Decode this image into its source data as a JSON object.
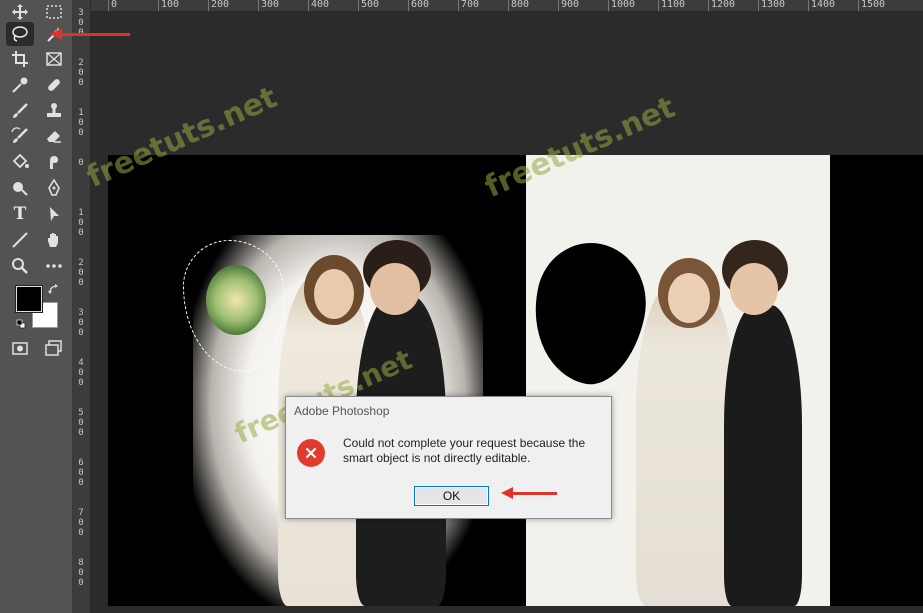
{
  "rulers": {
    "horizontal": [
      "0",
      "100",
      "200",
      "300",
      "400",
      "500",
      "600",
      "700",
      "800",
      "900",
      "1000",
      "1100",
      "1200",
      "1300",
      "1400",
      "1500"
    ],
    "vertical": [
      [
        "3",
        "0",
        "0"
      ],
      [
        "2",
        "0",
        "0"
      ],
      [
        "1",
        "0",
        "0"
      ],
      [
        "0"
      ],
      [
        "1",
        "0",
        "0"
      ],
      [
        "2",
        "0",
        "0"
      ],
      [
        "3",
        "0",
        "0"
      ],
      [
        "4",
        "0",
        "0"
      ],
      [
        "5",
        "0",
        "0"
      ],
      [
        "6",
        "0",
        "0"
      ],
      [
        "7",
        "0",
        "0"
      ],
      [
        "8",
        "0",
        "0"
      ]
    ]
  },
  "tools": {
    "icons": [
      "move-icon",
      "marquee-icon",
      "lasso-icon",
      "quick-selection-icon",
      "crop-icon",
      "frame-icon",
      "eyedropper-icon",
      "healing-brush-icon",
      "brush-icon",
      "clone-stamp-icon",
      "history-brush-icon",
      "eraser-icon",
      "paint-bucket-icon",
      "smudge-icon",
      "dodge-icon",
      "pen-icon",
      "type-icon",
      "path-selection-icon",
      "line-icon",
      "hand-icon",
      "zoom-icon",
      "more-tools-icon",
      "quick-mask-icon",
      "screen-mode-icon"
    ],
    "active": "lasso-icon",
    "type_glyph": "T"
  },
  "colors": {
    "foreground": "#000000",
    "background": "#ffffff",
    "accent_red": "#e0322a"
  },
  "watermarks": [
    "freetuts.net",
    "freetuts.net",
    "freetuts.net"
  ],
  "dialog": {
    "title": "Adobe Photoshop",
    "message": "Could not complete your request because the smart object is not directly editable.",
    "icon": "error-icon",
    "ok_label": "OK"
  }
}
